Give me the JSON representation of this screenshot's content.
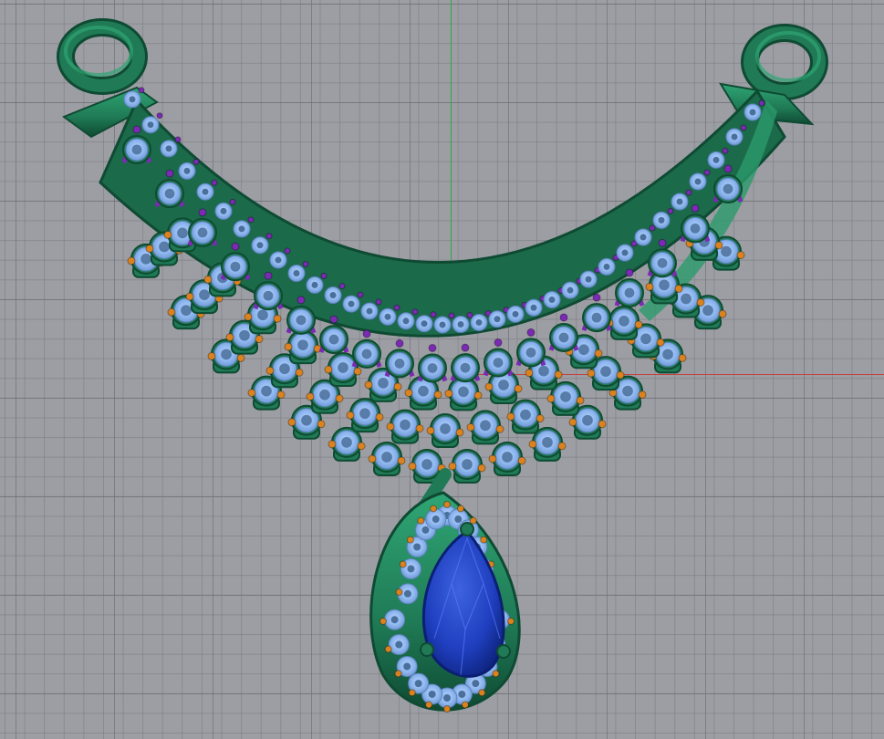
{
  "viewport": {
    "view_name": "Perspective",
    "grid": true,
    "background_color": "#9c9ea3",
    "axis_colors": {
      "x": "#c4433f",
      "y": "#2fa84a"
    }
  },
  "model": {
    "subject": "necklace-pendant-jewelry-render",
    "colors": {
      "metal": "#1f7a55",
      "metal_dark": "#0f4a33",
      "metal_light": "#2fa574",
      "diamond": "#8fb8f0",
      "diamond_core": "#4a6f9a",
      "amethyst_bead": "#7a2ab3",
      "gold_bead": "#d9821f",
      "sapphire": "#1f3fbf",
      "sapphire_dark": "#0b1f73"
    }
  }
}
